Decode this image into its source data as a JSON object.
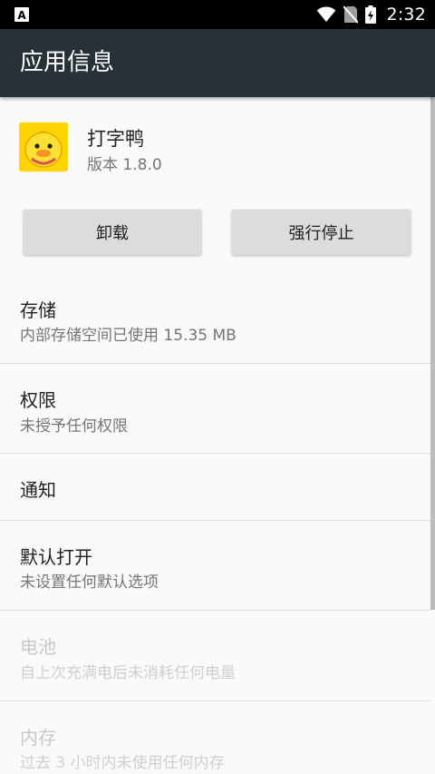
{
  "status_bar": {
    "time": "2:32",
    "icons": [
      "notification-a-icon",
      "wifi-icon",
      "no-sim-icon",
      "battery-charging-icon"
    ]
  },
  "toolbar": {
    "title": "应用信息"
  },
  "app": {
    "icon": "duck-app-icon",
    "name": "打字鸭",
    "version": "版本 1.8.0"
  },
  "buttons": {
    "uninstall": "卸载",
    "force_stop": "强行停止"
  },
  "items": [
    {
      "title": "存储",
      "summary": "内部存储空间已使用 15.35 MB",
      "enabled": true
    },
    {
      "title": "权限",
      "summary": "未授予任何权限",
      "enabled": true
    },
    {
      "title": "通知",
      "summary": "",
      "enabled": true
    },
    {
      "title": "默认打开",
      "summary": "未设置任何默认选项",
      "enabled": true
    },
    {
      "title": "电池",
      "summary": "自上次充满电后未消耗任何电量",
      "enabled": false
    },
    {
      "title": "内存",
      "summary": "过去 3 小时内未使用任何内存",
      "enabled": false
    }
  ]
}
